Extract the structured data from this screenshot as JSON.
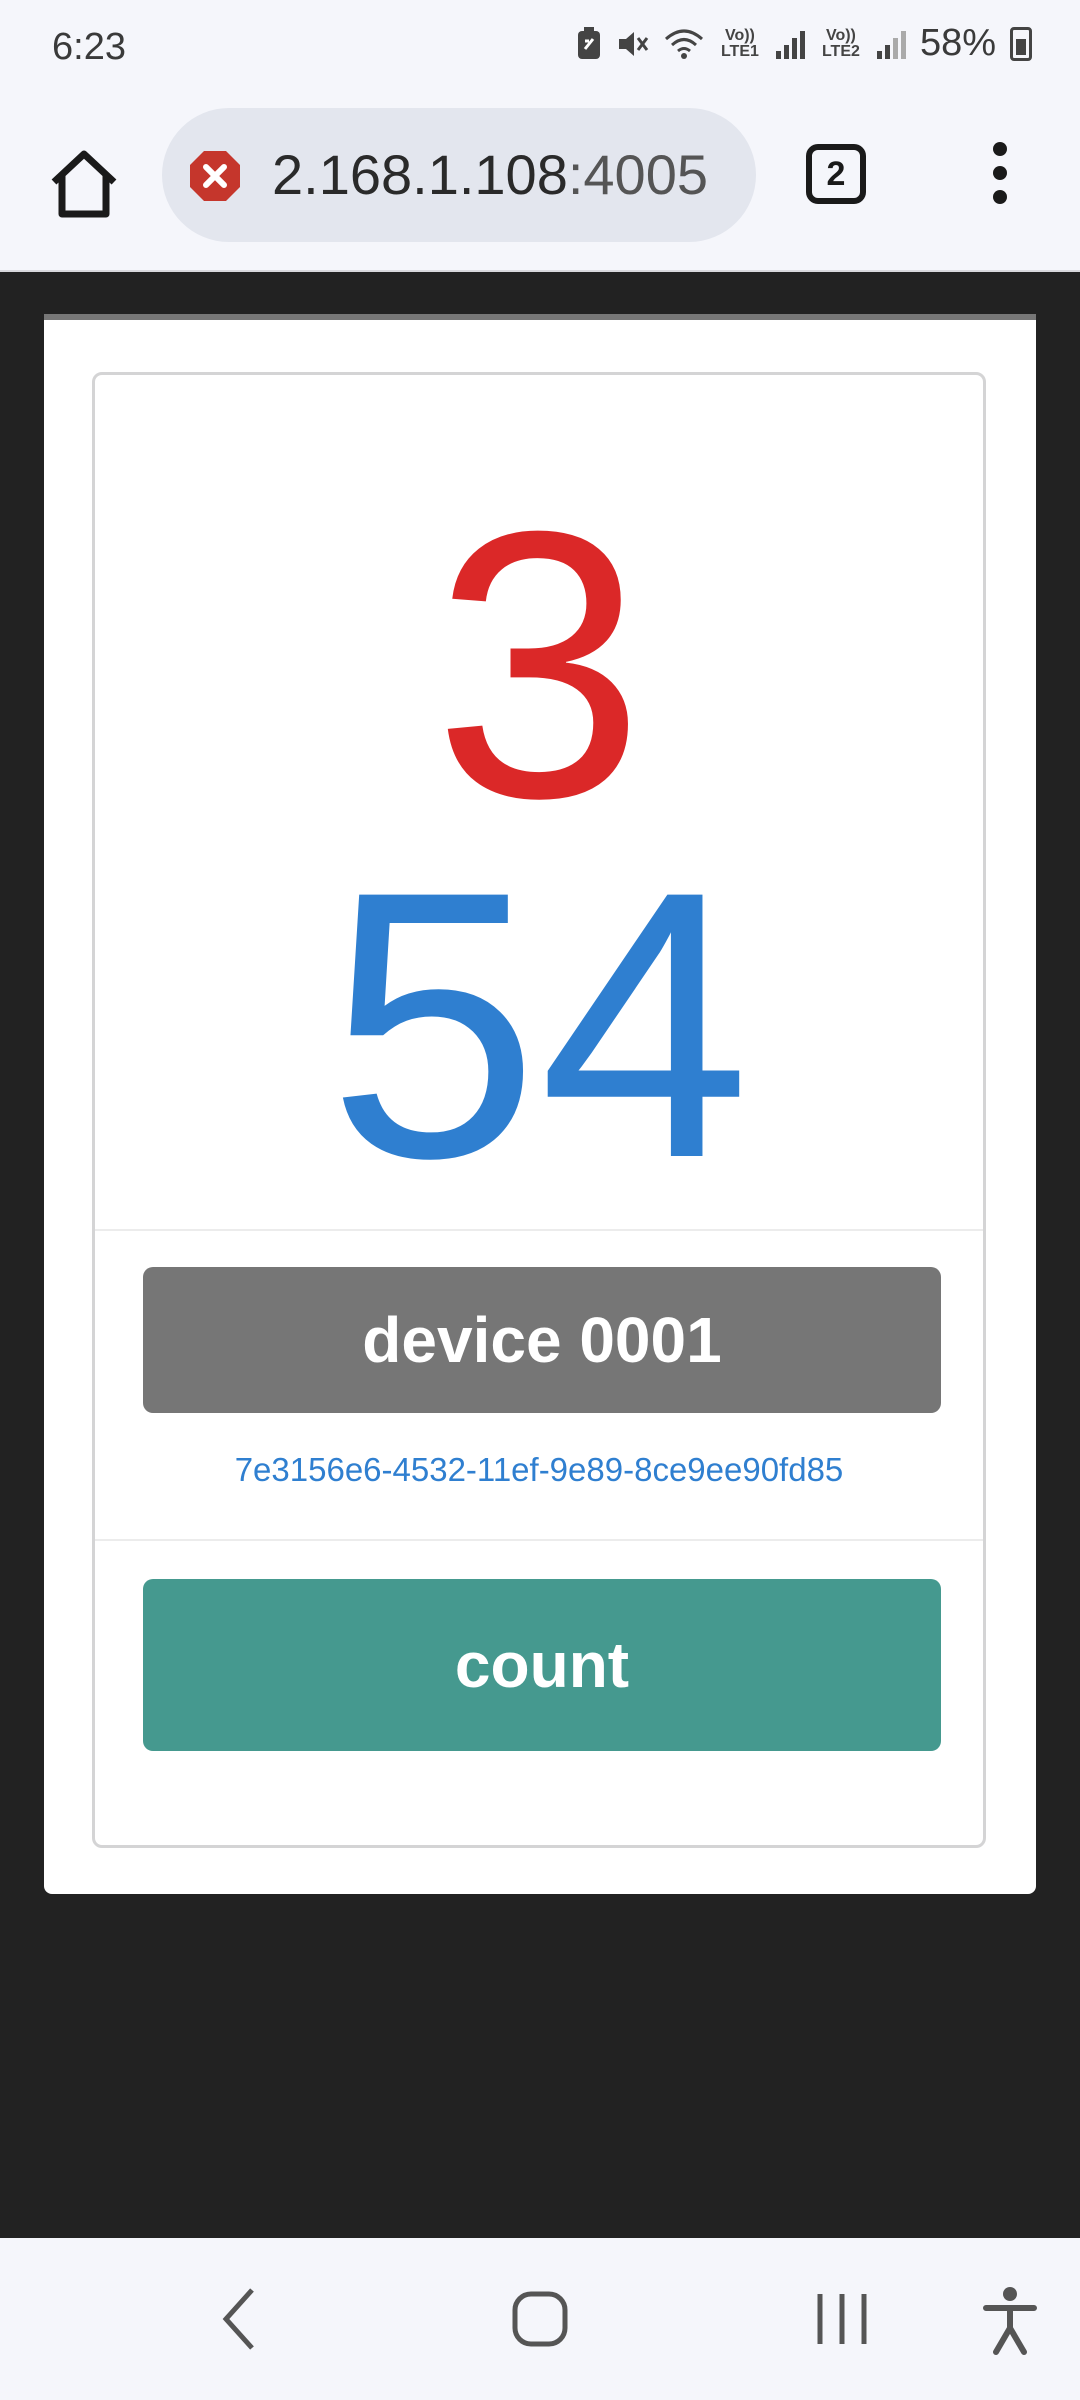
{
  "status_bar": {
    "time": "6:23",
    "sim1_label": "Vo)) LTE1",
    "sim2_label": "Vo)) LTE2",
    "battery": "58%"
  },
  "browser": {
    "url_visible": "2.168.1.108",
    "url_port": ":4005",
    "tab_count": "2",
    "icons": [
      "home-icon",
      "not-secure-icon",
      "tabs-icon",
      "more-vert-icon"
    ]
  },
  "page": {
    "number_top": "3",
    "number_bottom": "54",
    "device_label": "device 0001",
    "device_uuid": "7e3156e6-4532-11ef-9e89-8ce9ee90fd85",
    "count_button": "count",
    "colors": {
      "number_top": "#db2828",
      "number_bottom": "#2f7fd0",
      "device_label_bg": "#767676",
      "count_button_bg": "#45998f"
    }
  },
  "nav_bar": {
    "icons": [
      "back-icon",
      "home-circle-icon",
      "recents-icon",
      "accessibility-icon"
    ]
  }
}
